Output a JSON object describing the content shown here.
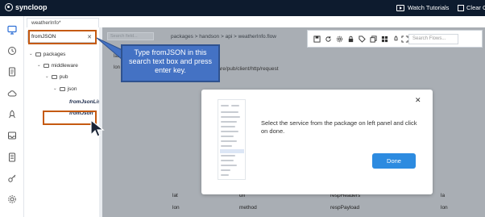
{
  "app": {
    "brand": "syncloop"
  },
  "topbar": {
    "tutorials": "Watch Tutorials",
    "clear": "Clear C"
  },
  "tab": {
    "label": "weatherInfo*"
  },
  "search": {
    "value": "fromJSON"
  },
  "tree": [
    {
      "label": "packages",
      "indent": 0,
      "kind": "folder"
    },
    {
      "label": "middleware",
      "indent": 1,
      "kind": "folder"
    },
    {
      "label": "pub",
      "indent": 2,
      "kind": "folder"
    },
    {
      "label": "json",
      "indent": 3,
      "kind": "folder"
    },
    {
      "label": "fromJsonLis",
      "indent": 4,
      "kind": "service"
    },
    {
      "label": "fromJson",
      "indent": 4,
      "kind": "service"
    }
  ],
  "workspace": {
    "faded_search": "Search field...",
    "breadcrumb": "packages  >  handson  >  api  >  weatherInfo.flow",
    "request_path": "iddleware/pub/client/http/request",
    "left_labels": [
      "lat",
      "lon"
    ],
    "filter_placeholder": "Search Flows..."
  },
  "bottom": {
    "col1": [
      "lat",
      "lon"
    ],
    "col2": [
      "url",
      "method"
    ],
    "col3": [
      "respHeaders",
      "respPayload"
    ],
    "col4": [
      "la",
      "lon"
    ]
  },
  "callout": {
    "text": "Type fromJSON in this search text box and press enter key."
  },
  "modal": {
    "message": "Select the service from the package on left panel and click on done.",
    "done": "Done",
    "close": "✕"
  },
  "colors": {
    "topbar": "#0d1b2e",
    "accent": "#2d8be0",
    "callout": "#4472c4",
    "highlight": "#c55a11"
  }
}
